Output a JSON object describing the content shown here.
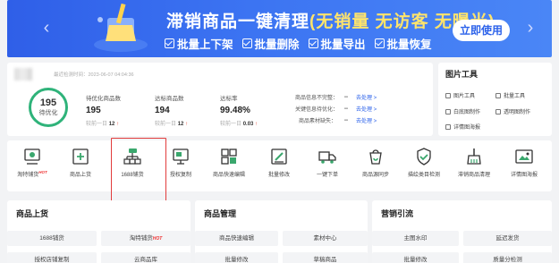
{
  "banner": {
    "title_main": "滞销商品一键清理",
    "title_tail": "(无销量 无访客 无曝光)",
    "features": [
      "批量上下架",
      "批量删除",
      "批量导出",
      "批量恢复"
    ],
    "cta_label": "立即使用"
  },
  "stats": {
    "scan_time": "最近检测时间：2023-06-07 04:04:36",
    "score_value": "195",
    "score_label": "待优化",
    "metrics": [
      {
        "label": "待优化商品数",
        "value": "195",
        "compare_prefix": "较前一日",
        "compare_value": "12",
        "trend": "↑"
      },
      {
        "label": "达标商品数",
        "value": "194",
        "compare_prefix": "较前一日",
        "compare_value": "12",
        "trend": "↑"
      },
      {
        "label": "达标率",
        "value": "99.48%",
        "compare_prefix": "较前一日",
        "compare_value": "0.03",
        "trend": "↑"
      }
    ],
    "issues": [
      {
        "label": "商品信息不完整：",
        "value": "--",
        "action": "去处理 >"
      },
      {
        "label": "关键信息待优化：",
        "value": "--",
        "action": "去处理 >"
      },
      {
        "label": "商品素材缺失：",
        "value": "--",
        "action": "去处理 >"
      }
    ]
  },
  "image_tools": {
    "title": "图片工具",
    "items": [
      "图片工具",
      "批量工具",
      "白底图制作",
      "透明图制作",
      "详情图海报"
    ]
  },
  "shortcuts": [
    {
      "label": "淘特铺货",
      "badge": "HOT",
      "icon": "taote-icon"
    },
    {
      "label": "商品上货",
      "icon": "upload-icon"
    },
    {
      "label": "1688铺货",
      "icon": "org-chart-icon"
    },
    {
      "label": "授权复制",
      "icon": "monitor-icon"
    },
    {
      "label": "商品快速编辑",
      "icon": "grid-edit-icon"
    },
    {
      "label": "批量修改",
      "icon": "edit-icon"
    },
    {
      "label": "一键下单",
      "icon": "truck-icon"
    },
    {
      "label": "商品源同步",
      "icon": "sync-icon"
    },
    {
      "label": "描绘类目检测",
      "icon": "shield-check-icon"
    },
    {
      "label": "滞销商品清理",
      "icon": "broom-icon"
    },
    {
      "label": "详情图海报",
      "icon": "poster-icon"
    }
  ],
  "sections": [
    {
      "title": "商品上货",
      "buttons": [
        "1688铺货",
        "淘特铺货",
        "授权店铺复制",
        "云商品库"
      ],
      "badge": "HOT"
    },
    {
      "title": "商品管理",
      "buttons": [
        "商品快速编辑",
        "素材中心",
        "批量修改",
        "草稿商品"
      ]
    },
    {
      "title": "营销引流",
      "buttons": [
        "主图水印",
        "延迟发货",
        "批量修改",
        "质量分检测"
      ]
    }
  ]
}
